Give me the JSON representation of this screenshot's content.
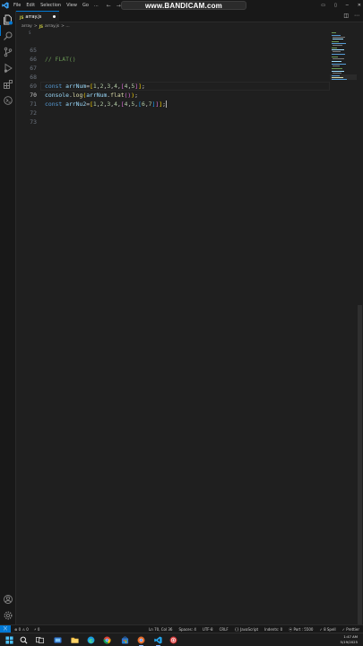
{
  "menubar": {
    "items": [
      "File",
      "Edit",
      "Selection",
      "View",
      "Go",
      "..."
    ],
    "watermark": "www.BANDICAM.com"
  },
  "tab": {
    "filename": "array.js",
    "badge": "JS"
  },
  "breadcrumb": {
    "folder": "array",
    "sep": ">",
    "badge": "JS",
    "file": "array.js",
    "rest": "> ..."
  },
  "editor": {
    "fold_hint": "S",
    "lines": [
      {
        "num": "65",
        "text": "// FLAT()"
      },
      {
        "num": "66",
        "text": ""
      },
      {
        "num": "67",
        "text": ""
      },
      {
        "num": "68",
        "text": "const arrNum=[1,2,3,4,[4,5]];"
      },
      {
        "num": "69",
        "text": "console.log(arrNum.flat());"
      },
      {
        "num": "70",
        "text": "const arrNu2=[1,2,3,4,[4,5,[6,7]]];"
      },
      {
        "num": "71",
        "text": ""
      },
      {
        "num": "72",
        "text": ""
      },
      {
        "num": "73",
        "text": ""
      }
    ],
    "current_line": "70"
  },
  "statusbar": {
    "errors": "⊗ 0 ⚠ 0",
    "ports": "⚡ 0",
    "position": "Ln 70, Col 36",
    "spaces": "Spaces: 4",
    "encoding": "UTF-8",
    "eol": "CRLF",
    "language": "{} JavaScript",
    "indents": "Indents: 0",
    "port": "⦿ Port : 5500",
    "spell": "✓ 8 Spell",
    "prettier": "✓ Prettier"
  },
  "taskbar": {
    "time": "1:47 AM",
    "date": "5/19/2025"
  },
  "colors": {
    "accent": "#0078d4",
    "background": "#1f1f1f",
    "chrome": "#181818"
  }
}
